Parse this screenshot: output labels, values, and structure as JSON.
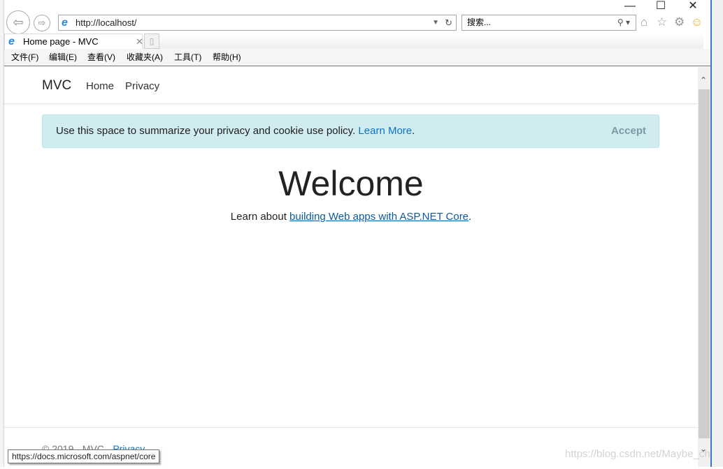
{
  "browser": {
    "address": "http://localhost/",
    "search_placeholder": "搜索...",
    "tab_title": "Home page - MVC",
    "menu": [
      "文件(F)",
      "编辑(E)",
      "查看(V)",
      "收藏夹(A)",
      "工具(T)",
      "帮助(H)"
    ],
    "status_tooltip": "https://docs.microsoft.com/aspnet/core"
  },
  "nav": {
    "brand": "MVC",
    "links": [
      "Home",
      "Privacy"
    ]
  },
  "cookie": {
    "text": "Use this space to summarize your privacy and cookie use policy.",
    "link": "Learn More",
    "period": ".",
    "accept": "Accept"
  },
  "main": {
    "title": "Welcome",
    "lead_prefix": "Learn about ",
    "lead_link": "building Web apps with ASP.NET Core",
    "lead_suffix": "."
  },
  "footer": {
    "copyright": "© 2019 - MVC - ",
    "privacy": "Privacy"
  },
  "watermark": "https://blog.csdn.net/Maybe_ch"
}
